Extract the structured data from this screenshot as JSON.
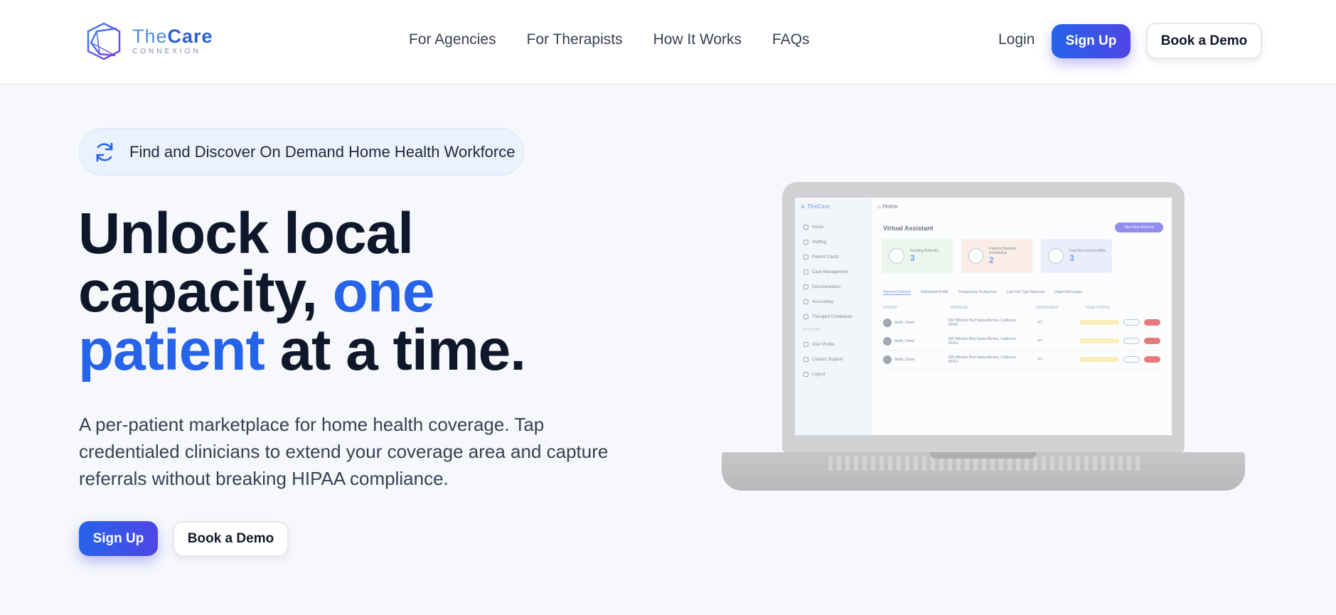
{
  "brand": {
    "name_light": "The",
    "name_bold": "Care",
    "subtitle": "CONNEXION",
    "accent": "#2563eb"
  },
  "nav": {
    "links": [
      "For Agencies",
      "For Therapists",
      "How It Works",
      "FAQs"
    ],
    "login_label": "Login",
    "signup_label": "Sign Up",
    "demo_label": "Book a Demo"
  },
  "hero": {
    "pill_icon": "refresh-icon",
    "pill_text": "Find and Discover On Demand Home Health Workforce",
    "title_line1": "Unlock local",
    "title_line2_a": "capacity, ",
    "title_line2_b": "one",
    "title_line3_a": "patient",
    "title_line3_b": " at a time.",
    "description": "A per-patient marketplace for home health coverage. Tap credentialed clinicians to extend your coverage area and capture referrals without breaking HIPAA compliance.",
    "signup_label": "Sign Up",
    "demo_label": "Book a Demo"
  },
  "mockup": {
    "brand": "TheCare",
    "breadcrumb": "Home",
    "sidebar": [
      "Home",
      "Staffing",
      "Patient Charts",
      "Case Management",
      "Documentation",
      "Accounting",
      "Therapist Credentials"
    ],
    "sidebar_section": "ACCOUNT",
    "sidebar_account": [
      "User Profile",
      "Contact Support",
      "Logout"
    ],
    "title": "Virtual Assistant",
    "new_referral": "Start New Referral",
    "cards": [
      {
        "label": "Pending Referrals",
        "value": "3",
        "bg": "#e6f6e3"
      },
      {
        "label": "Patients Needing Scheduling",
        "value": "2",
        "bg": "#fbe6d8"
      },
      {
        "label": "Past Due Invoices/Bills",
        "value": "3",
        "bg": "#e6e7fb"
      }
    ],
    "tabs": [
      "Approval Needed",
      "Unfinished Profile",
      "Frequencies To Approve",
      "Last Visit Type Approval",
      "Urgent Messages"
    ],
    "columns": [
      "PATIENT",
      "ADDRESS",
      "DISCIPLINES",
      "CASE STATUS"
    ],
    "rows": [
      {
        "patient": "Smith, David",
        "address": "900 Wilshire Blvd Santa Monica, California, 90401",
        "discipline": "PT"
      },
      {
        "patient": "Smith, David",
        "address": "900 Wilshire Blvd Santa Monica, California, 90401",
        "discipline": "PT"
      },
      {
        "patient": "Smith, David",
        "address": "900 Wilshire Blvd Santa Monica, California, 90401",
        "discipline": "PT"
      }
    ]
  }
}
